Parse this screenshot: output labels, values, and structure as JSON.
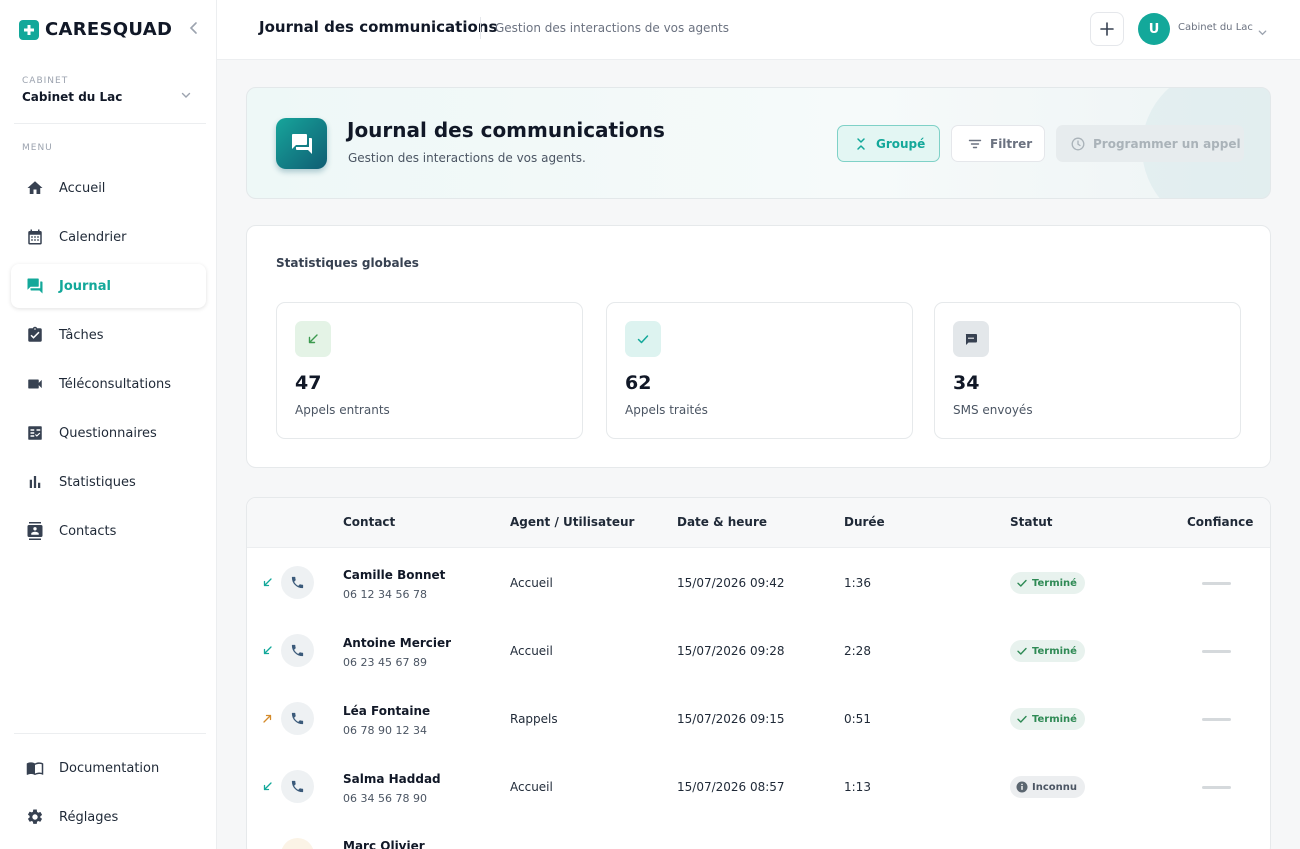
{
  "app": {
    "brand": "CARESQUAD",
    "colors": {
      "primary": "#13a89a",
      "text": "#111827",
      "muted": "#6b7280"
    }
  },
  "sidebar": {
    "cabinet_caption": "CABINET",
    "cabinet_name": "Cabinet du Lac",
    "menu_caption": "MENU",
    "items": [
      {
        "label": "Accueil",
        "icon": "home-icon"
      },
      {
        "label": "Calendrier",
        "icon": "calendar-icon"
      },
      {
        "label": "Journal",
        "icon": "chat-icon",
        "active": true
      },
      {
        "label": "Tâches",
        "icon": "clipboard-check-icon"
      },
      {
        "label": "Téléconsultations",
        "icon": "video-icon"
      },
      {
        "label": "Questionnaires",
        "icon": "checklist-icon"
      },
      {
        "label": "Statistiques",
        "icon": "bar-chart-icon"
      },
      {
        "label": "Contacts",
        "icon": "contact-card-icon"
      }
    ],
    "footer_items": [
      {
        "label": "Documentation",
        "icon": "book-icon"
      },
      {
        "label": "Réglages",
        "icon": "gear-icon"
      }
    ]
  },
  "header": {
    "title": "Journal des communications",
    "subtitle": "Gestion des interactions de vos agents",
    "avatar_initial": "U",
    "user_label": "Cabinet du Lac"
  },
  "hero": {
    "title": "Journal des communications",
    "subtitle": "Gestion des interactions de vos agents.",
    "group_button": "Groupé",
    "filter_button": "Filtrer",
    "schedule_button": "Programmer un appel"
  },
  "stats": {
    "title": "Statistiques globales",
    "cards": [
      {
        "value": "47",
        "label": "Appels entrants",
        "icon": "arrow-incoming-icon",
        "color": "#3c9a4f",
        "bg": "#e4f3e6"
      },
      {
        "value": "62",
        "label": "Appels traités",
        "icon": "check-icon",
        "color": "#13a89a",
        "bg": "#ddf3f0"
      },
      {
        "value": "34",
        "label": "SMS envoyés",
        "icon": "sms-icon",
        "color": "#374151",
        "bg": "#e3e7ea"
      }
    ]
  },
  "table": {
    "headers": {
      "contact": "Contact",
      "agent": "Agent / Utilisateur",
      "date": "Date & heure",
      "duration": "Durée",
      "status": "Statut",
      "confidence": "Confiance"
    },
    "rows": [
      {
        "name": "Camille Bonnet",
        "phone": "06 12 34 56 78",
        "agent": "Accueil",
        "date": "15/07/2026 09:42",
        "duration": "1:36",
        "status": "Terminé",
        "direction": "incoming"
      },
      {
        "name": "Antoine Mercier",
        "phone": "06 23 45 67 89",
        "agent": "Accueil",
        "date": "15/07/2026 09:28",
        "duration": "2:28",
        "status": "Terminé",
        "direction": "incoming"
      },
      {
        "name": "Léa Fontaine",
        "phone": "06 78 90 12 34",
        "agent": "Rappels",
        "date": "15/07/2026 09:15",
        "duration": "0:51",
        "status": "Terminé",
        "direction": "outgoing"
      },
      {
        "name": "Salma Haddad",
        "phone": "06 34 56 78 90",
        "agent": "Accueil",
        "date": "15/07/2026 08:57",
        "duration": "1:13",
        "status": "Inconnu",
        "direction": "incoming"
      },
      {
        "name": "Marc Olivier"
      }
    ]
  }
}
